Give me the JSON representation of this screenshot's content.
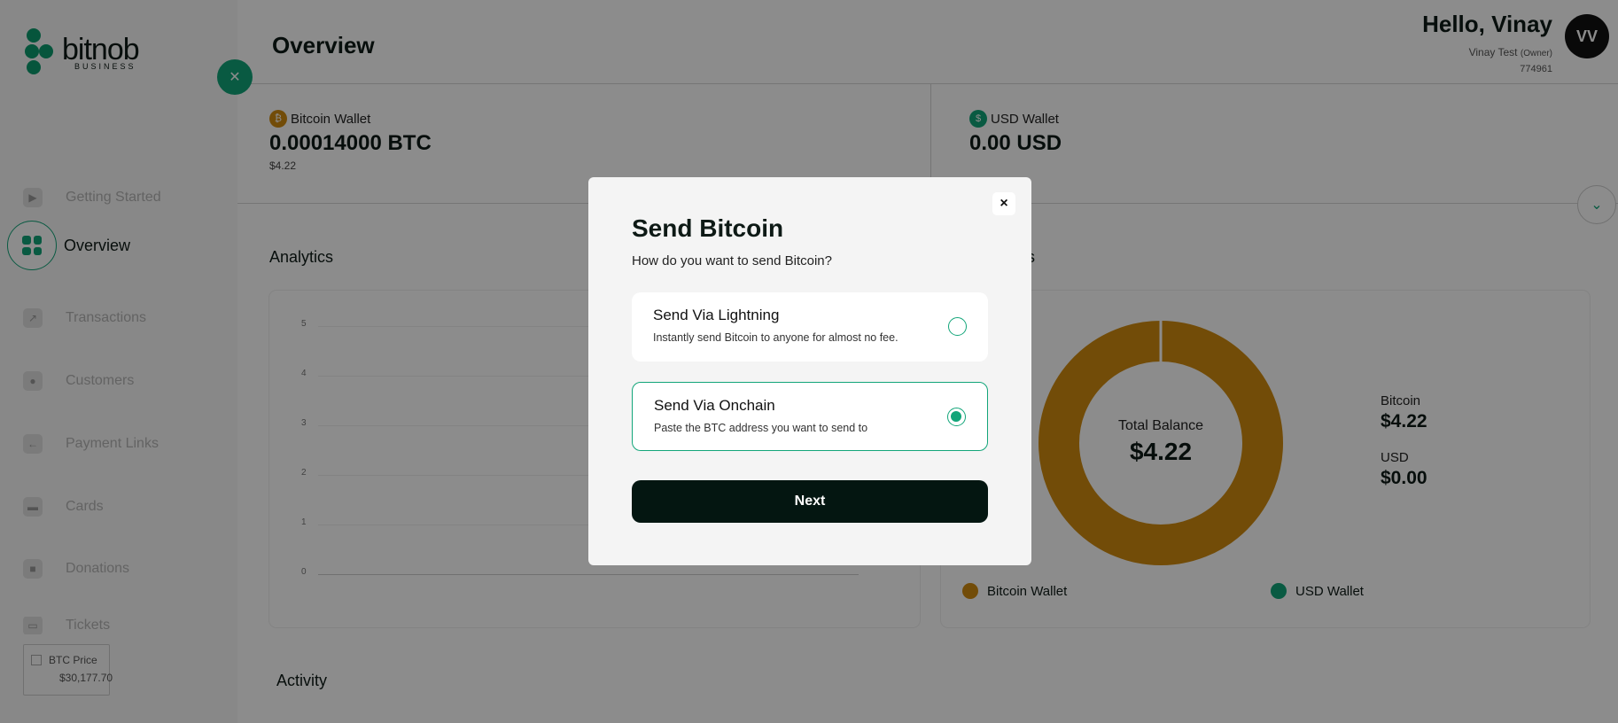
{
  "brand": {
    "word": "bitnob",
    "sub": "BUSINESS"
  },
  "sidebar": {
    "items": [
      {
        "label": "Getting Started",
        "icon": "play-icon"
      },
      {
        "label": "Overview",
        "icon": "dashboard-icon",
        "active": true
      },
      {
        "label": "Transactions",
        "icon": "chart-icon"
      },
      {
        "label": "Customers",
        "icon": "users-icon"
      },
      {
        "label": "Payment Links",
        "icon": "link-icon"
      },
      {
        "label": "Cards",
        "icon": "card-icon"
      },
      {
        "label": "Donations",
        "icon": "gift-icon"
      },
      {
        "label": "Tickets",
        "icon": "ticket-icon"
      }
    ],
    "btc_price": {
      "label": "BTC Price",
      "value": "$30,177.70"
    }
  },
  "header": {
    "title": "Overview",
    "greeting": "Hello, Vinay",
    "user_name": "Vinay Test",
    "user_role": "(Owner)",
    "user_id": "774961",
    "avatar": "VV"
  },
  "wallets": {
    "bitcoin": {
      "label": "Bitcoin Wallet",
      "amount": "0.00014000 BTC",
      "fiat": "$4.22",
      "color": "#d08a10"
    },
    "usd": {
      "label": "USD Wallet",
      "amount": "0.00 USD",
      "color": "#12a579"
    }
  },
  "analytics": {
    "title": "Analytics",
    "yticks": [
      "5",
      "4",
      "3",
      "2",
      "1",
      "0"
    ]
  },
  "balances": {
    "title_visible": "ces",
    "center_label": "Total Balance",
    "center_value": "$4.22",
    "bitcoin_label": "Bitcoin",
    "bitcoin_value": "$4.22",
    "usd_label": "USD",
    "usd_value": "$0.00",
    "legend_bitcoin": "Bitcoin Wallet",
    "legend_usd": "USD Wallet",
    "colors": {
      "bitcoin": "#d08a10",
      "usd": "#12a579"
    }
  },
  "activity": {
    "title": "Activity"
  },
  "modal": {
    "title": "Send Bitcoin",
    "subtitle": "How do you want to send Bitcoin?",
    "options": [
      {
        "title": "Send Via Lightning",
        "desc": "Instantly send Bitcoin to anyone for almost no fee.",
        "selected": false
      },
      {
        "title": "Send Via Onchain",
        "desc": "Paste the BTC address you want to send to",
        "selected": true
      }
    ],
    "next_label": "Next",
    "close_icon": "×"
  }
}
